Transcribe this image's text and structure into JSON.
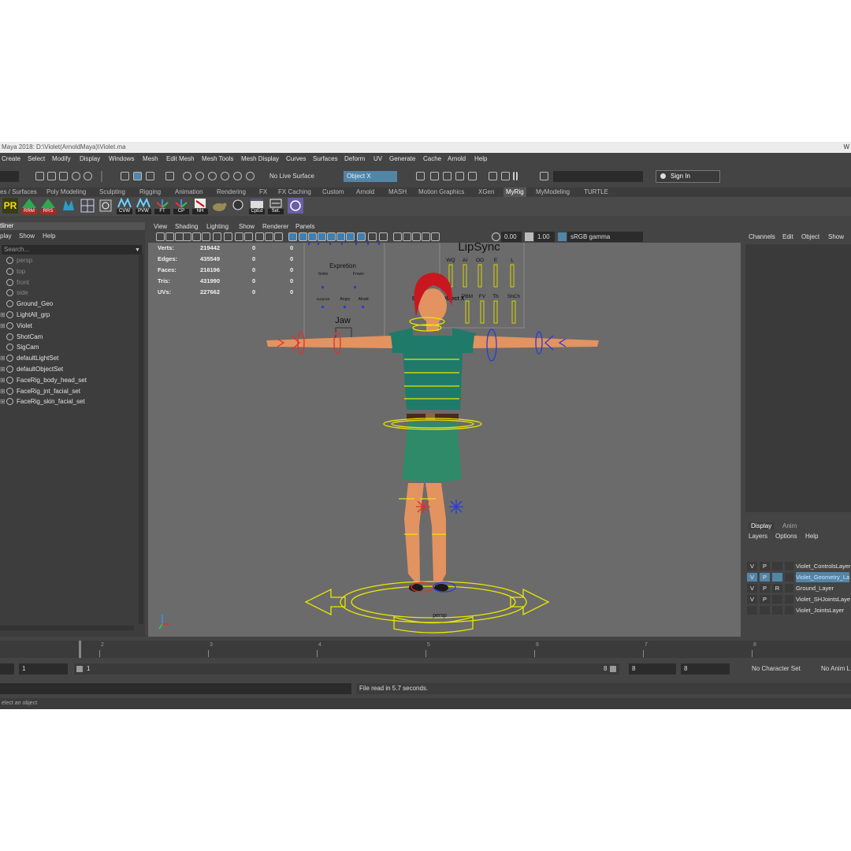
{
  "window": {
    "title": "Maya 2018: D:\\Violet(ArnoldMaya)\\Violet.ma",
    "right_fragment": "W"
  },
  "menus": [
    "Create",
    "Select",
    "Modify",
    "Display",
    "Windows",
    "Mesh",
    "Edit Mesh",
    "Mesh Tools",
    "Mesh Display",
    "Curves",
    "Surfaces",
    "Deform",
    "UV",
    "Generate",
    "Cache",
    "Arnold",
    "Help"
  ],
  "toolbar": {
    "live_surface": "No Live Surface",
    "symmetry": "Object X",
    "sign_in": "Sign In"
  },
  "shelf_tabs": [
    "es / Surfaces",
    "Poly Modeling",
    "Sculpting",
    "Rigging",
    "Animation",
    "Rendering",
    "FX",
    "FX Caching",
    "Custom",
    "Arnold",
    "MASH",
    "Motion Graphics",
    "XGen",
    "MyRig",
    "MyModeling",
    "TURTLE"
  ],
  "shelf_active": "MyRig",
  "shelf_buttons": [
    "PR",
    "RRM",
    "RRS",
    "",
    "",
    "",
    "CVW",
    "PVW",
    "FT",
    "CP",
    "NH",
    "",
    "",
    "CpEd",
    "Set.",
    ""
  ],
  "outliner": {
    "title": "tliner",
    "menu": [
      "play",
      "Show",
      "Help"
    ],
    "search_placeholder": "Search...",
    "items": [
      {
        "label": "persp",
        "dim": true,
        "plus": false
      },
      {
        "label": "top",
        "dim": true,
        "plus": false
      },
      {
        "label": "front",
        "dim": true,
        "plus": false
      },
      {
        "label": "side",
        "dim": true,
        "plus": false
      },
      {
        "label": "Ground_Geo",
        "dim": false,
        "plus": false
      },
      {
        "label": "LightAll_grp",
        "dim": false,
        "plus": true
      },
      {
        "label": "Violet",
        "dim": false,
        "plus": true
      },
      {
        "label": "ShotCam",
        "dim": false,
        "plus": false
      },
      {
        "label": "SigCam",
        "dim": false,
        "plus": false
      },
      {
        "label": "defaultLightSet",
        "dim": false,
        "plus": true
      },
      {
        "label": "defaultObjectSet",
        "dim": false,
        "plus": true
      },
      {
        "label": "FaceRig_body_head_set",
        "dim": false,
        "plus": true
      },
      {
        "label": "FaceRig_jnt_facial_set",
        "dim": false,
        "plus": true
      },
      {
        "label": "FaceRig_skin_facial_set",
        "dim": false,
        "plus": true
      }
    ]
  },
  "viewport": {
    "menu": [
      "View",
      "Shading",
      "Lighting",
      "Show",
      "Renderer",
      "Panels"
    ],
    "exposure": "0.00",
    "gamma": "1.00",
    "color_space": "sRGB gamma",
    "hud": [
      {
        "label": "Verts:",
        "value": "219442",
        "c1": "0",
        "c2": "0"
      },
      {
        "label": "Edges:",
        "value": "435549",
        "c1": "0",
        "c2": "0"
      },
      {
        "label": "Faces:",
        "value": "216196",
        "c1": "0",
        "c2": "0"
      },
      {
        "label": "Tris:",
        "value": "431990",
        "c1": "0",
        "c2": "0"
      },
      {
        "label": "UVs:",
        "value": "227662",
        "c1": "0",
        "c2": "0"
      }
    ],
    "symmetry_label": "Symmetry: Object X",
    "camera_label": "persp",
    "face_panel": {
      "expression_title": "Expretion",
      "smile": "Smile",
      "frown": "Frown",
      "surprise": "Surprise",
      "angry": "Angry",
      "afraid": "Afraid",
      "jaw": "Jaw",
      "lipsync_title": "LipSync",
      "visemes_top": [
        "WQ",
        "AI",
        "OO",
        "E",
        "L"
      ],
      "visemes_bottom": [
        "PBM",
        "FV",
        "Th",
        "ShCh"
      ]
    }
  },
  "channel_box": {
    "menu": [
      "Channels",
      "Edit",
      "Object",
      "Show"
    ]
  },
  "layer_editor": {
    "tabs": [
      "Display",
      "Anim"
    ],
    "menu": [
      "Layers",
      "Options",
      "Help"
    ],
    "layers": [
      {
        "v": "V",
        "p": "P",
        "r": "",
        "name": "Violet_ControlsLayer",
        "selected": false
      },
      {
        "v": "V",
        "p": "P",
        "r": "",
        "name": "Violet_Geometry_La",
        "selected": true
      },
      {
        "v": "V",
        "p": "P",
        "r": "R",
        "name": "Ground_Layer",
        "selected": false
      },
      {
        "v": "V",
        "p": "P",
        "r": "",
        "name": "Violet_SHJointsLaye",
        "selected": false
      },
      {
        "v": "",
        "p": "",
        "r": "",
        "name": "Violet_JointsLayer",
        "selected": false
      }
    ]
  },
  "timeline": {
    "ticks": [
      "2",
      "3",
      "4",
      "5",
      "6",
      "7",
      "8"
    ],
    "range_start": "1",
    "range_inner_start": "1",
    "range_inner_end": "8",
    "range_end": "8",
    "anim_end": "8",
    "character_set": "No Character Set",
    "anim_layer": "No Anim L"
  },
  "status": {
    "message": "File read in  5.7 seconds.",
    "help": "elect an object"
  },
  "colors": {
    "ui_bg": "#444444",
    "viewport_bg": "#6b6b6b",
    "selection_blue": "#5285a6",
    "control_yellow": "#e8e800",
    "control_red": "#e03030",
    "control_blue": "#2a3ad8"
  }
}
